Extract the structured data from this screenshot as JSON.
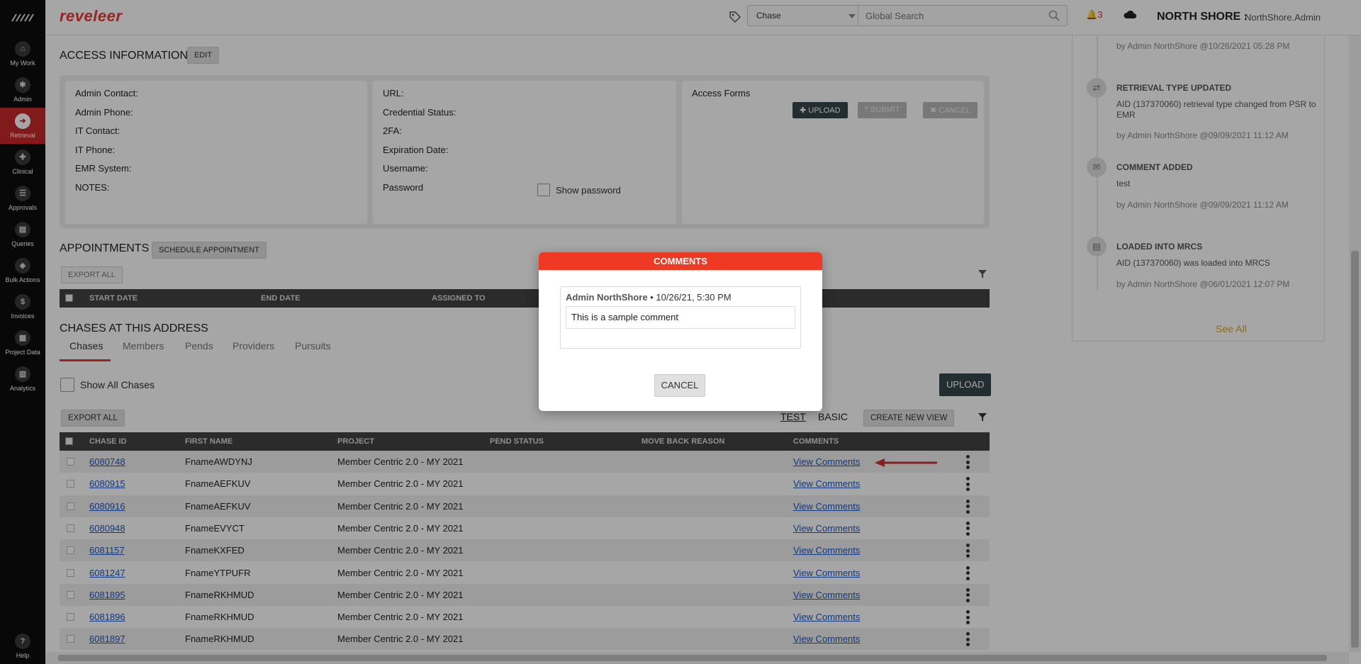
{
  "app": {
    "brand": "reveleer",
    "org": "NORTH SHORE :",
    "user": "NorthShore.Admin",
    "notifications": "3"
  },
  "topbar": {
    "chase_select": "Chase",
    "search_placeholder": "Global Search"
  },
  "leftnav": [
    {
      "label": "My Work",
      "glyph": "⌂"
    },
    {
      "label": "Admin",
      "glyph": "✱"
    },
    {
      "label": "Retrieval",
      "glyph": "➜",
      "active": true
    },
    {
      "label": "Clinical",
      "glyph": "✚"
    },
    {
      "label": "Approvals",
      "glyph": "☰"
    },
    {
      "label": "Queries",
      "glyph": "▤"
    },
    {
      "label": "Bulk Actions",
      "glyph": "◈"
    },
    {
      "label": "Invoices",
      "glyph": "$"
    },
    {
      "label": "Project Data",
      "glyph": "▦"
    },
    {
      "label": "Analytics",
      "glyph": "▥"
    }
  ],
  "help_label": "Help",
  "access": {
    "title": "ACCESS INFORMATION",
    "edit": "EDIT",
    "col1": [
      "Admin Contact:",
      "Admin Phone:",
      "IT Contact:",
      "IT Phone:",
      "EMR System:",
      "NOTES:"
    ],
    "col2": [
      "URL:",
      "Credential Status:",
      "2FA:",
      "Expiration Date:",
      "Username:",
      "Password"
    ],
    "show_password": "Show password",
    "forms_title": "Access Forms",
    "upload": "UPLOAD",
    "submit": "SUBMIT",
    "cancel": "CANCEL"
  },
  "appointments": {
    "title": "APPOINTMENTS",
    "schedule": "SCHEDULE APPOINTMENT",
    "export_all": "EXPORT ALL",
    "columns": [
      "START DATE",
      "END DATE",
      "ASSIGNED TO"
    ]
  },
  "chases": {
    "title": "CHASES AT THIS ADDRESS",
    "tabs": [
      "Chases",
      "Members",
      "Pends",
      "Providers",
      "Pursuits"
    ],
    "show_all": "Show All Chases",
    "upload": "UPLOAD",
    "export_all": "EXPORT ALL",
    "view_test": "TEST",
    "view_basic": "BASIC",
    "create_view": "CREATE NEW VIEW",
    "columns": [
      "CHASE ID",
      "FIRST NAME",
      "PROJECT",
      "PEND STATUS",
      "MOVE BACK REASON",
      "COMMENTS"
    ],
    "rows": [
      {
        "id": "6080748",
        "first": "FnameAWDYNJ",
        "project": "Member Centric 2.0 - MY 2021",
        "comments": "View Comments"
      },
      {
        "id": "6080915",
        "first": "FnameAEFKUV",
        "project": "Member Centric 2.0 - MY 2021",
        "comments": "View Comments"
      },
      {
        "id": "6080916",
        "first": "FnameAEFKUV",
        "project": "Member Centric 2.0 - MY 2021",
        "comments": "View Comments"
      },
      {
        "id": "6080948",
        "first": "FnameEVYCT",
        "project": "Member Centric 2.0 - MY 2021",
        "comments": "View Comments"
      },
      {
        "id": "6081157",
        "first": "FnameKXFED",
        "project": "Member Centric 2.0 - MY 2021",
        "comments": "View Comments"
      },
      {
        "id": "6081247",
        "first": "FnameYTPUFR",
        "project": "Member Centric 2.0 - MY 2021",
        "comments": "View Comments"
      },
      {
        "id": "6081895",
        "first": "FnameRKHMUD",
        "project": "Member Centric 2.0 - MY 2021",
        "comments": "View Comments"
      },
      {
        "id": "6081896",
        "first": "FnameRKHMUD",
        "project": "Member Centric 2.0 - MY 2021",
        "comments": "View Comments"
      },
      {
        "id": "6081897",
        "first": "FnameRKHMUD",
        "project": "Member Centric 2.0 - MY 2021",
        "comments": "View Comments"
      }
    ]
  },
  "timeline": {
    "items": [
      {
        "title": "",
        "desc": "",
        "by": "by Admin NorthShore @10/26/2021 05:28 PM"
      },
      {
        "title": "RETRIEVAL TYPE UPDATED",
        "desc": "AID (137370060) retrieval type changed from PSR to EMR",
        "by": "by Admin NorthShore @09/09/2021 11:12 AM",
        "icon": "⇄"
      },
      {
        "title": "COMMENT ADDED",
        "desc": "test",
        "by": "by Admin NorthShore @09/09/2021 11:12 AM",
        "icon": "✉"
      },
      {
        "title": "LOADED INTO MRCS",
        "desc": "AID (137370060) was loaded into MRCS",
        "by": "by Admin NorthShore @06/01/2021 12:07 PM",
        "icon": "▤"
      }
    ],
    "see_all": "See All"
  },
  "modal": {
    "title": "COMMENTS",
    "author": "Admin NorthShore",
    "timestamp": " • 10/26/21, 5:30 PM",
    "comment": "This is a sample comment",
    "cancel": "CANCEL"
  },
  "colors": {
    "accent": "#e53935",
    "modal_header": "#ee3a24",
    "link": "#1a56c4",
    "see_all": "#e6a21a"
  }
}
